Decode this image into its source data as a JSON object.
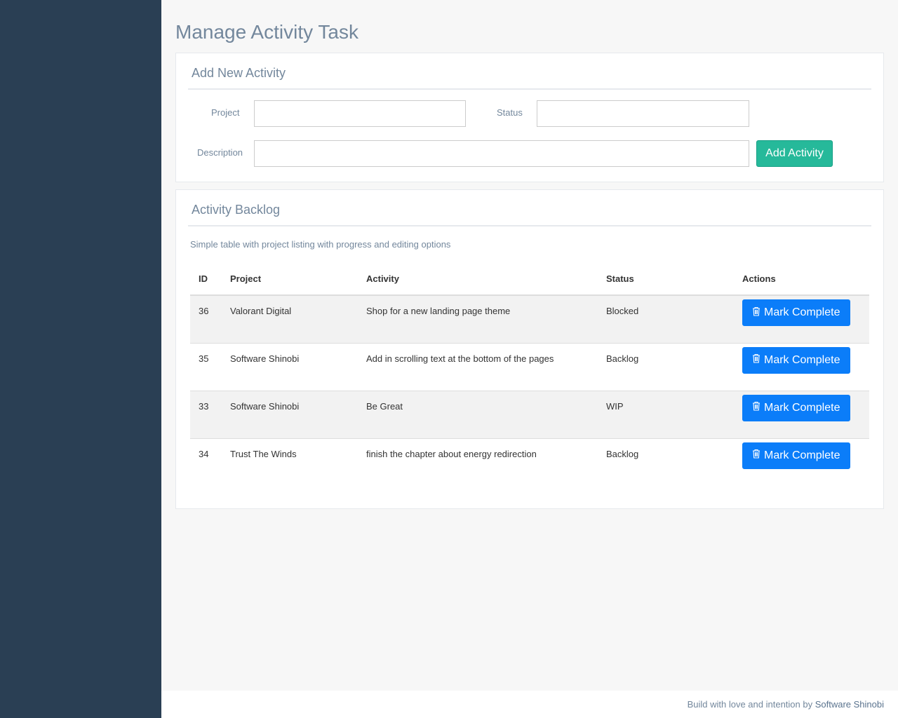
{
  "page": {
    "title": "Manage Activity Task"
  },
  "add_panel": {
    "title": "Add New Activity",
    "project_label": "Project",
    "status_label": "Status",
    "description_label": "Description",
    "project_value": "",
    "status_value": "",
    "description_value": "",
    "add_button": "Add Activity"
  },
  "backlog_panel": {
    "title": "Activity Backlog",
    "subtitle": "Simple table with project listing with progress and editing options",
    "columns": [
      "ID",
      "Project",
      "Activity",
      "Status",
      "Actions"
    ],
    "rows": [
      {
        "id": "36",
        "project": "Valorant Digital",
        "activity": "Shop for a new landing page theme",
        "status": "Blocked",
        "action": "Mark Complete"
      },
      {
        "id": "35",
        "project": "Software Shinobi",
        "activity": "Add in scrolling text at the bottom of the pages",
        "status": "Backlog",
        "action": "Mark Complete"
      },
      {
        "id": "33",
        "project": "Software Shinobi",
        "activity": "Be Great",
        "status": "WIP",
        "action": "Mark Complete"
      },
      {
        "id": "34",
        "project": "Trust The Winds",
        "activity": "finish the chapter about energy redirection",
        "status": "Backlog",
        "action": "Mark Complete"
      }
    ]
  },
  "footer": {
    "text": "Build with love and intention by ",
    "link": "Software Shinobi"
  },
  "colors": {
    "sidebar": "#2a3f54",
    "add_button": "#26b99a",
    "mark_button": "#0b7df9",
    "title": "#73879c"
  },
  "icons": {
    "mark_complete": "trash-icon"
  }
}
